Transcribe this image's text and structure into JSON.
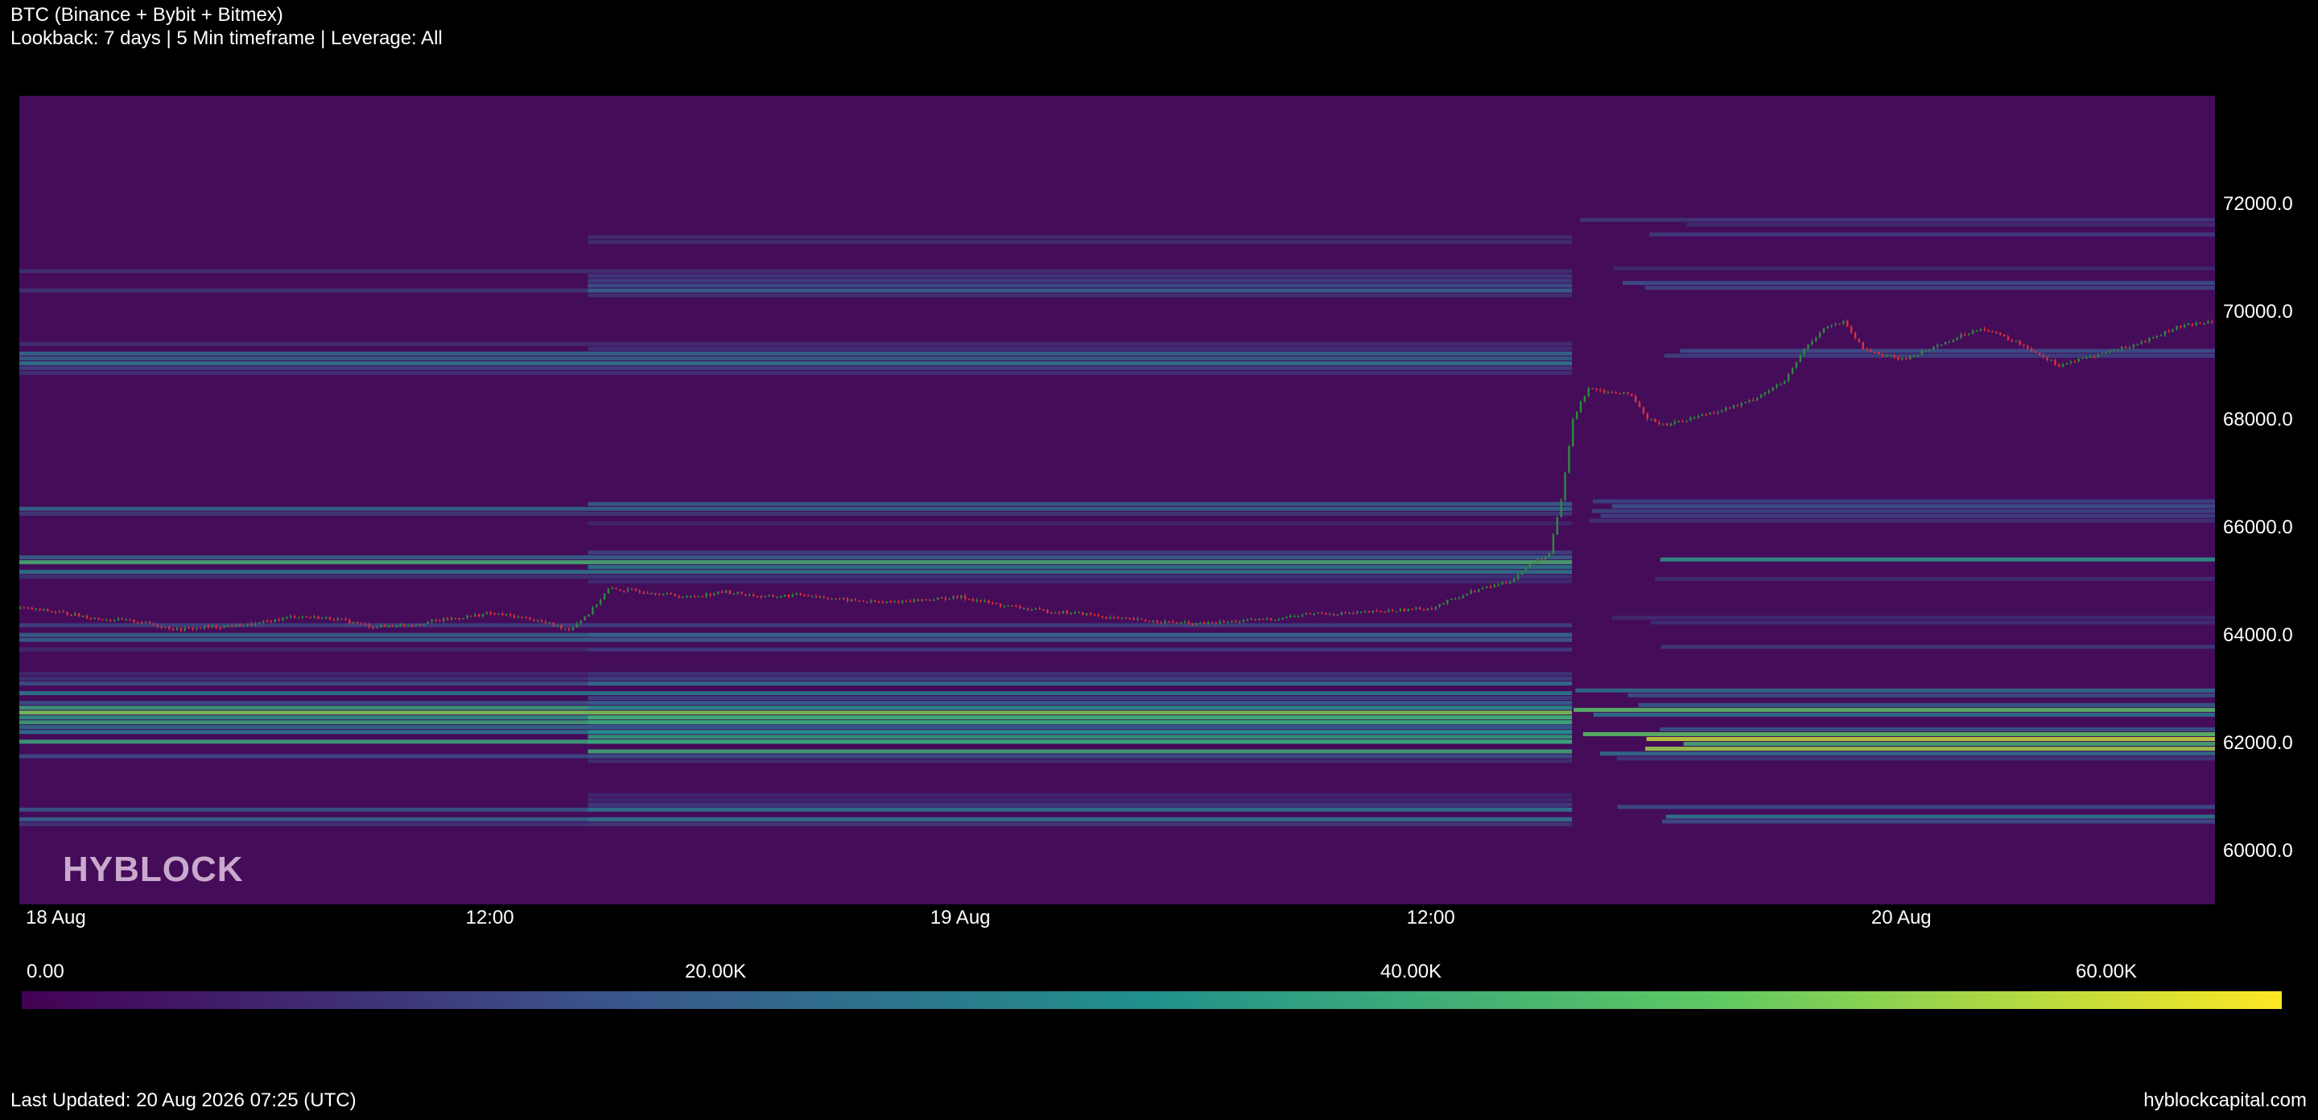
{
  "header": {
    "title": "BTC (Binance + Bybit + Bitmex)",
    "subtitle": "Lookback: 7 days | 5 Min timeframe | Leverage: All"
  },
  "footer": {
    "last_updated": "Last Updated: 20 Aug 2026 07:25 (UTC)",
    "site": "hyblockcapital.com"
  },
  "watermark": "HYBLOCK",
  "colors": {
    "background": "#000000",
    "heatmap_base": "#440c59",
    "candle_up": "#2e8b3d",
    "candle_down": "#e0303a",
    "colorbar": [
      "#440154",
      "#3b528b",
      "#21918c",
      "#5ec962",
      "#fde725"
    ]
  },
  "chart_data": {
    "type": "heatmap",
    "x_ticks": [
      "18 Aug",
      "12:00",
      "19 Aug",
      "12:00",
      "20 Aug"
    ],
    "x_range_hours": [
      0,
      56
    ],
    "y_ticks": [
      "72000.0",
      "70000.0",
      "68000.0",
      "66000.0",
      "64000.0",
      "62000.0",
      "60000.0"
    ],
    "y_tick_values": [
      72000,
      70000,
      68000,
      66000,
      64000,
      62000,
      60000
    ],
    "ylim": [
      59000,
      74000
    ],
    "colorbar": {
      "ticks": [
        "0.00",
        "20.00K",
        "40.00K",
        "60.00K"
      ],
      "tick_values": [
        0,
        20000,
        40000,
        60000
      ],
      "range": [
        0,
        65000
      ]
    },
    "price_series": [
      [
        0,
        64500
      ],
      [
        1,
        64420
      ],
      [
        2,
        64300
      ],
      [
        3,
        64250
      ],
      [
        4,
        64100
      ],
      [
        5,
        64150
      ],
      [
        6,
        64200
      ],
      [
        7,
        64350
      ],
      [
        8,
        64300
      ],
      [
        9,
        64150
      ],
      [
        10,
        64200
      ],
      [
        11,
        64300
      ],
      [
        12,
        64400
      ],
      [
        13,
        64300
      ],
      [
        14,
        64100
      ],
      [
        14.5,
        64400
      ],
      [
        15,
        64850
      ],
      [
        16,
        64800
      ],
      [
        17,
        64700
      ],
      [
        18,
        64800
      ],
      [
        19,
        64700
      ],
      [
        20,
        64750
      ],
      [
        21,
        64650
      ],
      [
        22,
        64600
      ],
      [
        23,
        64650
      ],
      [
        24,
        64700
      ],
      [
        25,
        64550
      ],
      [
        26,
        64450
      ],
      [
        27,
        64400
      ],
      [
        28,
        64300
      ],
      [
        29,
        64250
      ],
      [
        30,
        64200
      ],
      [
        31,
        64250
      ],
      [
        32,
        64300
      ],
      [
        33,
        64400
      ],
      [
        34,
        64400
      ],
      [
        35,
        64450
      ],
      [
        36,
        64500
      ],
      [
        37,
        64800
      ],
      [
        38,
        65000
      ],
      [
        38.5,
        65300
      ],
      [
        39,
        65500
      ],
      [
        39.3,
        66500
      ],
      [
        39.6,
        68000
      ],
      [
        40,
        68600
      ],
      [
        40.5,
        68500
      ],
      [
        41,
        68500
      ],
      [
        41.5,
        68000
      ],
      [
        42,
        67900
      ],
      [
        43,
        68100
      ],
      [
        44,
        68300
      ],
      [
        45,
        68700
      ],
      [
        45.5,
        69300
      ],
      [
        46,
        69700
      ],
      [
        46.5,
        69800
      ],
      [
        47,
        69300
      ],
      [
        48,
        69100
      ],
      [
        49,
        69400
      ],
      [
        50,
        69700
      ],
      [
        51,
        69400
      ],
      [
        52,
        69000
      ],
      [
        53,
        69200
      ],
      [
        54,
        69400
      ],
      [
        55,
        69700
      ],
      [
        56,
        69850
      ]
    ]
  }
}
